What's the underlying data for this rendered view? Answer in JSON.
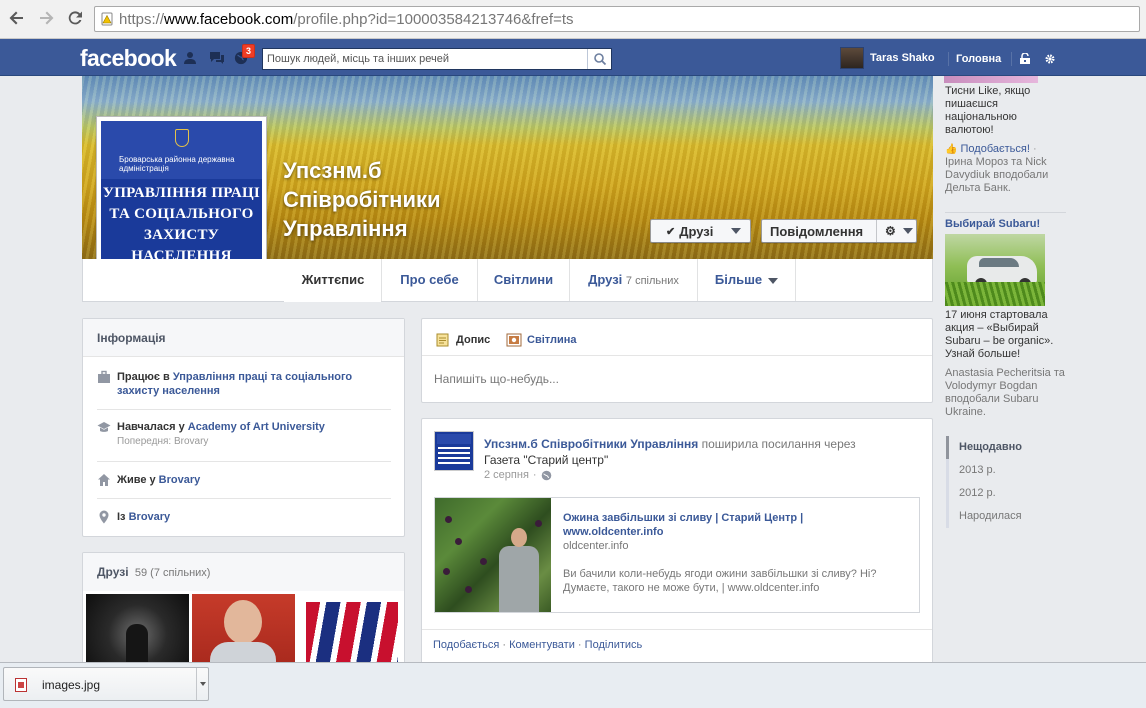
{
  "browser": {
    "url_prefix": "https://",
    "url_host": "www.facebook.com",
    "url_path": "/profile.php?id=100003584213746&fref=ts"
  },
  "topbar": {
    "logo": "facebook",
    "notification_count": "3",
    "search_placeholder": "Пошук людей, місць та інших речей",
    "user_name": "Taras Shako",
    "home_label": "Головна"
  },
  "profile": {
    "name": "Упсзнм.б Співробітники Управління",
    "name_lines": [
      "Упсзнм.б",
      "Співробітники",
      "Управління"
    ],
    "pic_small_text": "Броварська районна державна адміністрація",
    "pic_big_lines": [
      "УПРАВЛІННЯ ПРАЦІ",
      "ТА СОЦІАЛЬНОГО",
      "ЗАХИСТУ",
      "НАСЕЛЕННЯ"
    ],
    "friends_button": "Друзі",
    "message_button": "Повідомлення"
  },
  "tabs": [
    {
      "label": "Життєпис"
    },
    {
      "label": "Про себе"
    },
    {
      "label": "Світлини"
    },
    {
      "label": "Друзі",
      "count": "7 спільних"
    },
    {
      "label": "Більше"
    }
  ],
  "info": {
    "title": "Інформація",
    "work_pre": "Працює в ",
    "work_place": "Управління праці та соціального захисту населення",
    "study_pre": "Навчалася у ",
    "study_place": "Academy of Art University",
    "study_prev": "Попередня: Brovary",
    "lives_pre": "Живе у ",
    "lives_place": "Brovary",
    "from_pre": "Із ",
    "from_place": "Brovary"
  },
  "friends_card": {
    "title": "Друзі",
    "count": "59 (7 спільних)"
  },
  "composer": {
    "tab_post": "Допис",
    "tab_photo": "Світлина",
    "placeholder": "Напишіть що-небудь..."
  },
  "post": {
    "author": "Упсзнм.б Співробітники Управління",
    "action": " поширила посилання через",
    "via": "Газета \"Старий центр\"",
    "date": "2 серпня",
    "link_title": "Ожина завбільшки зі сливу | Старий Центр | www.oldcenter.info",
    "link_domain": "oldcenter.info",
    "link_desc": "Ви бачили коли-небудь ягоди ожини завбільшки зі сливу? Ні? Думаєте, такого не може бути, | www.oldcenter.info",
    "like": "Подобається",
    "comment": "Коментувати",
    "share": "Поділитись"
  },
  "sidebar": {
    "ad1_text": "Тисни Like, якщо пишаєшся національною валютою!",
    "ad1_like": "Подобається!",
    "ad1_social": "Ірина Мороз та Nick Davydiuk вподобали Дельта Банк.",
    "ad2_title": "Выбирай Subaru!",
    "ad2_text": "17 июня стартовала акция – «Выбирай Subaru – be organic». Узнай больше!",
    "ad2_social": "Anastasia Pecheritsia та Volodymyr Bogdan вподобали Subaru Ukraine."
  },
  "timeline": [
    "Нещодавно",
    "2013 р.",
    "2012 р.",
    "Народилася"
  ],
  "download": {
    "filename": "images.jpg"
  },
  "colors": {
    "fb_blue": "#3b5998",
    "link_blue": "#3b5998",
    "badge_red": "#f03d25"
  }
}
